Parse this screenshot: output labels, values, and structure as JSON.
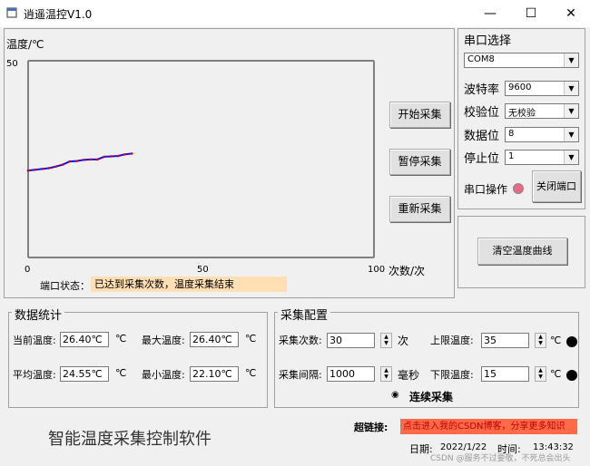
{
  "window": {
    "title": "逍遥温控V1.0",
    "min_icon": "minimize-icon",
    "max_icon": "maximize-icon",
    "close_icon": "close-icon"
  },
  "chart": {
    "ylabel": "温度/℃",
    "ymax_label": "50",
    "xticks": [
      "0",
      "50",
      "100"
    ],
    "xlabel": "次数/次",
    "line_color": "#1010ee",
    "marker_color": "#e00000"
  },
  "chart_data": {
    "type": "line",
    "title": "",
    "xlabel": "次数/次",
    "ylabel": "温度/℃",
    "xlim": [
      0,
      100
    ],
    "ylim": [
      0,
      50
    ],
    "series": [
      {
        "x": [
          0,
          2,
          4,
          6,
          8,
          10,
          12,
          14,
          16,
          18,
          20,
          22,
          24,
          26,
          28,
          30
        ],
        "values": [
          22.1,
          22.3,
          22.5,
          22.7,
          23.1,
          23.6,
          24.4,
          24.5,
          24.8,
          24.9,
          24.9,
          25.6,
          25.7,
          25.8,
          26.2,
          26.4
        ]
      }
    ]
  },
  "status": {
    "label": "端口状态：",
    "text": "已达到采集次数，温度采集结束"
  },
  "buttons": {
    "start": "开始采集",
    "pause": "暂停采集",
    "restart": "重新采集",
    "clear": "清空温度曲线",
    "close_port": "关闭端口"
  },
  "serial": {
    "group_title": "串口选择",
    "port": "COM8",
    "baud_label": "波特率",
    "baud": "9600",
    "parity_label": "校验位",
    "parity": "无校验",
    "databits_label": "数据位",
    "databits": "8",
    "stopbits_label": "停止位",
    "stopbits": "1",
    "op_label": "串口操作",
    "indicator_color": "#e86a86"
  },
  "stats": {
    "group_title": "数据统计",
    "current_label": "当前温度:",
    "current": "26.40℃",
    "current_unit": "℃",
    "max_label": "最大温度:",
    "max": "26.40℃",
    "max_unit": "℃",
    "avg_label": "平均温度:",
    "avg": "24.55℃",
    "avg_unit": "℃",
    "min_label": "最小温度:",
    "min": "22.10℃",
    "min_unit": "℃"
  },
  "config": {
    "group_title": "采集配置",
    "count_label": "采集次数:",
    "count": "30",
    "count_unit": "次",
    "interval_label": "采集间隔:",
    "interval": "1000",
    "interval_unit": "毫秒",
    "upper_label": "上限温度:",
    "upper": "35",
    "upper_unit": "℃",
    "lower_label": "下限温度:",
    "lower": "15",
    "lower_unit": "℃",
    "continuous_label": "连续采集"
  },
  "footer": {
    "app_name": "智能温度采集控制软件",
    "link_label": "超链接:",
    "link_text": "点击进入我的CSDN博客，分享更多知识",
    "date_label": "日期:",
    "date": "2022/1/22",
    "time_label": "时间:",
    "time": "13:43:32",
    "watermark": "CSDN @服务不过要敬，不死总会出头"
  }
}
